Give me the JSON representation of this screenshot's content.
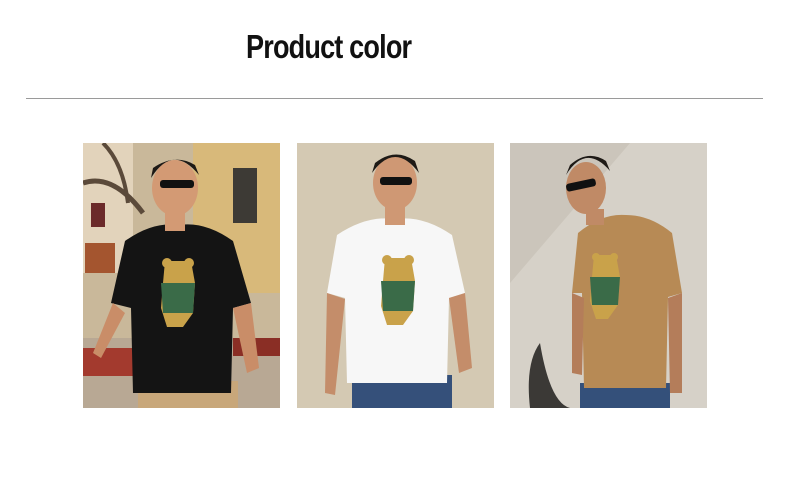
{
  "heading": {
    "title": "Product color"
  },
  "products": [
    {
      "color_name": "black",
      "shirt_color": "#141414"
    },
    {
      "color_name": "white",
      "shirt_color": "#f7f7f7"
    },
    {
      "color_name": "khaki",
      "shirt_color": "#b78a55"
    }
  ]
}
